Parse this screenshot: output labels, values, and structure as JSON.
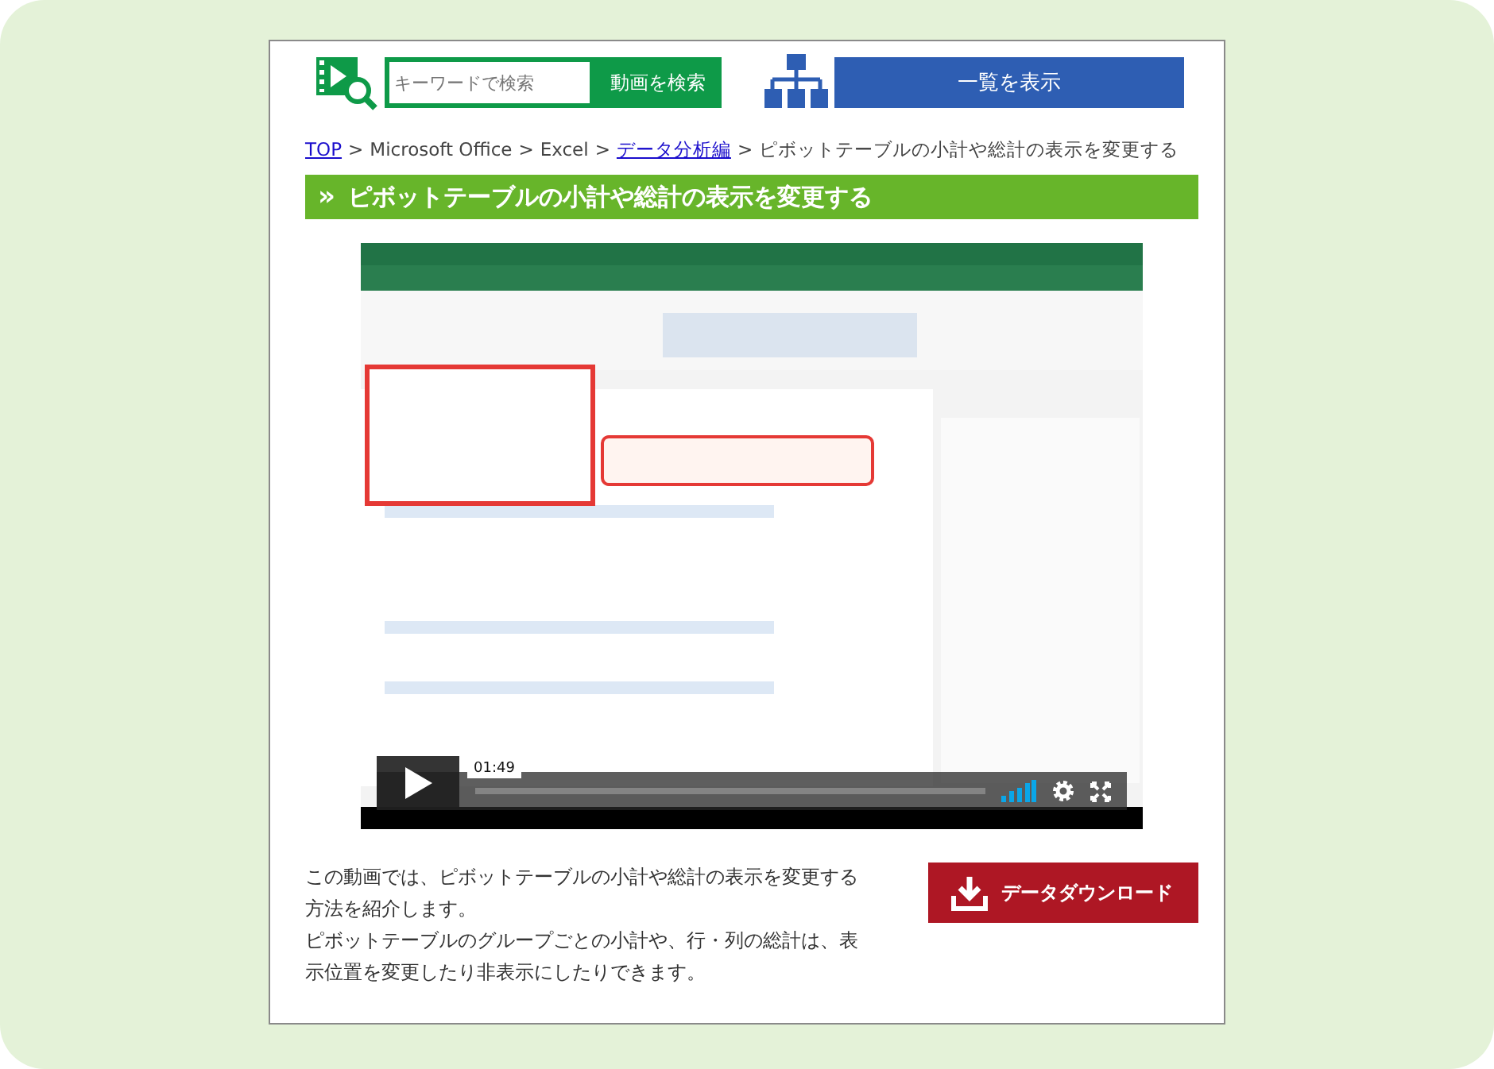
{
  "search": {
    "placeholder": "キーワードで検索",
    "button": "動画を検索"
  },
  "list_button": "一覧を表示",
  "breadcrumb": {
    "separator": ">",
    "items": [
      {
        "text": "TOP",
        "link": true
      },
      {
        "text": "Microsoft Office",
        "link": false
      },
      {
        "text": "Excel",
        "link": false
      },
      {
        "text": "データ分析編",
        "link": true
      },
      {
        "text": "ピボットテーブルの小計や総計の表示を変更する",
        "link": false
      }
    ]
  },
  "heading": {
    "marker": "»",
    "text": "ピボットテーブルの小計や総計の表示を変更する"
  },
  "video": {
    "kind": "picture",
    "time": "01:49"
  },
  "description": [
    "この動画では、ピボットテーブルの小計や総計の表示を変更する方法を紹介します。",
    "ピボットテーブルのグループごとの小計や、行・列の総計は、表示位置を変更したり非表示にしたりできます。"
  ],
  "download_button": "データダウンロード"
}
